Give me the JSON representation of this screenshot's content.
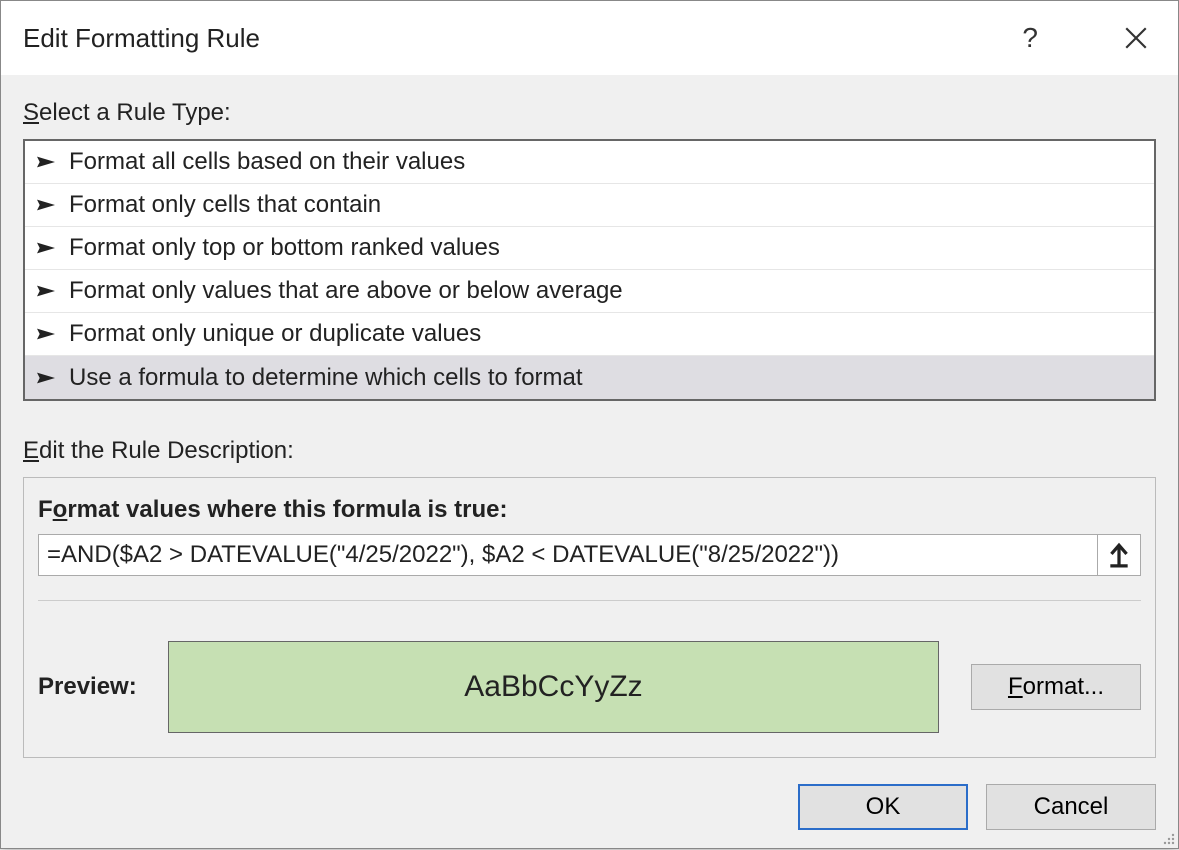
{
  "dialog": {
    "title": "Edit Formatting Rule",
    "help_tooltip": "?",
    "rule_type_label_prefix_ul": "S",
    "rule_type_label_rest": "elect a Rule Type:",
    "rule_types": [
      "Format all cells based on their values",
      "Format only cells that contain",
      "Format only top or bottom ranked values",
      "Format only values that are above or below average",
      "Format only unique or duplicate values",
      "Use a formula to determine which cells to format"
    ],
    "edit_desc_prefix_ul": "E",
    "edit_desc_rest": "dit the Rule Description:",
    "formula_label_prefix": "F",
    "formula_label_ul": "o",
    "formula_label_rest": "rmat values where this formula is true:",
    "formula_value": "=AND($A2 > DATEVALUE(\"4/25/2022\"), $A2 < DATEVALUE(\"8/25/2022\"))",
    "preview_label": "Preview:",
    "preview_sample": "AaBbCcYyZz",
    "preview_bg": "#c6e0b3",
    "format_button_ul": "F",
    "format_button_rest": "ormat...",
    "ok_label": "OK",
    "cancel_label": "Cancel",
    "selected_rule_index": 5
  }
}
